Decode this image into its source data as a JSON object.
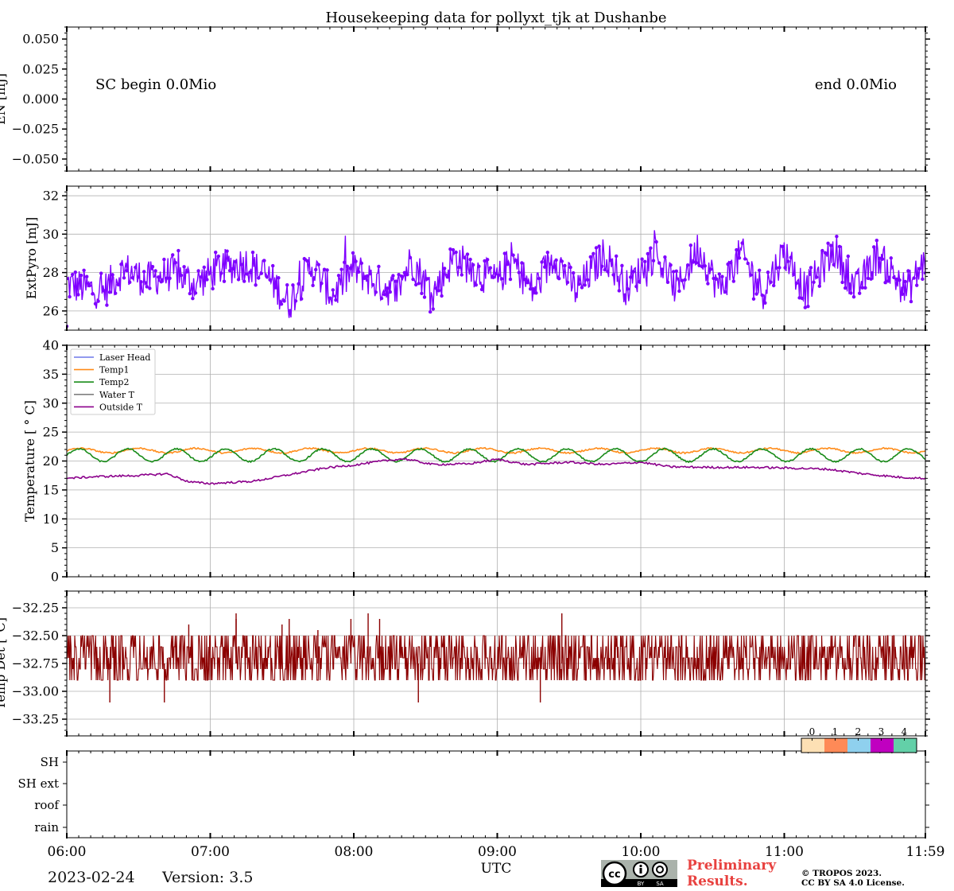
{
  "chart_data": {
    "type": "line",
    "title": "Housekeeping data for pollyxt_tjk at Dushanbe",
    "xlabel": "UTC",
    "x_ticks": [
      "06:00",
      "07:00",
      "08:00",
      "09:00",
      "10:00",
      "11:00",
      "11:59"
    ],
    "x_range_hours": [
      6.0,
      11.9833
    ],
    "panels": [
      {
        "id": "energy",
        "ylabel": "EN [mJ]",
        "ylim": [
          -0.06,
          0.06
        ],
        "yticks": [
          "0.050",
          "0.025",
          "0.000",
          "−0.025",
          "−0.050"
        ],
        "ytick_values": [
          0.05,
          0.025,
          0.0,
          -0.025,
          -0.05
        ],
        "annotations": [
          "SC begin 0.0Mio",
          "end 0.0Mio"
        ],
        "grid": false
      },
      {
        "id": "extpyro",
        "ylabel": "ExtPyro [mJ]",
        "ylim": [
          25.0,
          32.5
        ],
        "yticks": [
          "32",
          "30",
          "28",
          "26"
        ],
        "ytick_values": [
          32,
          30,
          28,
          26
        ],
        "grid": true,
        "series": [
          {
            "color": "#7f00ff",
            "marker": "dot",
            "base_points": [
              [
                6.0,
                27.4
              ],
              [
                6.25,
                27.0
              ],
              [
                6.4,
                28.2
              ],
              [
                6.55,
                27.6
              ],
              [
                6.75,
                28.0
              ],
              [
                6.9,
                27.4
              ],
              [
                7.05,
                28.2
              ],
              [
                7.25,
                28.5
              ],
              [
                7.4,
                27.8
              ],
              [
                7.55,
                26.4
              ],
              [
                7.7,
                28.4
              ],
              [
                7.85,
                26.8
              ],
              [
                8.0,
                28.2
              ],
              [
                8.15,
                27.5
              ],
              [
                8.3,
                27.0
              ],
              [
                8.4,
                28.7
              ],
              [
                8.55,
                26.9
              ],
              [
                8.7,
                28.8
              ],
              [
                8.85,
                28.1
              ],
              [
                9.0,
                27.5
              ],
              [
                9.1,
                28.7
              ],
              [
                9.25,
                27.0
              ],
              [
                9.4,
                28.9
              ],
              [
                9.55,
                27.0
              ],
              [
                9.75,
                29.0
              ],
              [
                9.9,
                27.2
              ],
              [
                10.1,
                29.0
              ],
              [
                10.25,
                27.1
              ],
              [
                10.4,
                29.3
              ],
              [
                10.55,
                27.1
              ],
              [
                10.7,
                29.0
              ],
              [
                10.85,
                27.0
              ],
              [
                11.0,
                29.1
              ],
              [
                11.15,
                27.0
              ],
              [
                11.35,
                29.2
              ],
              [
                11.5,
                27.1
              ],
              [
                11.65,
                28.9
              ],
              [
                11.85,
                27.0
              ],
              [
                11.98,
                28.6
              ]
            ],
            "amplitude": 1.2
          }
        ]
      },
      {
        "id": "temperature",
        "ylabel": "Temperature [$^\\circ$C]",
        "ylim": [
          0,
          40
        ],
        "yticks": [
          "40",
          "35",
          "30",
          "25",
          "20",
          "15",
          "10",
          "5",
          "0"
        ],
        "ytick_values": [
          40,
          35,
          30,
          25,
          20,
          15,
          10,
          5,
          0
        ],
        "grid": true,
        "legend": "top-left",
        "series": [
          {
            "name": "Laser Head",
            "color": "#6f79e8",
            "points": []
          },
          {
            "name": "Temp1",
            "color": "#ff8c1a",
            "base": 21.8,
            "wave_amplitude": 0.4,
            "wave_period_hours": 0.4
          },
          {
            "name": "Temp2",
            "color": "#1a8c1a",
            "base": 21.0,
            "wave_amplitude": 1.1,
            "wave_period_hours": 0.34
          },
          {
            "name": "Water T",
            "color": "#808080",
            "points": []
          },
          {
            "name": "Outside T",
            "color": "#8b008b",
            "points": [
              [
                6.0,
                17.0
              ],
              [
                6.2,
                17.3
              ],
              [
                6.5,
                17.5
              ],
              [
                6.7,
                17.8
              ],
              [
                6.85,
                16.4
              ],
              [
                7.0,
                16.1
              ],
              [
                7.3,
                16.5
              ],
              [
                7.5,
                17.4
              ],
              [
                7.8,
                18.8
              ],
              [
                8.0,
                19.3
              ],
              [
                8.2,
                20.0
              ],
              [
                8.35,
                20.4
              ],
              [
                8.55,
                19.4
              ],
              [
                8.8,
                19.5
              ],
              [
                9.0,
                20.3
              ],
              [
                9.2,
                19.4
              ],
              [
                9.5,
                19.8
              ],
              [
                9.75,
                19.4
              ],
              [
                10.0,
                19.8
              ],
              [
                10.2,
                19.0
              ],
              [
                10.5,
                18.9
              ],
              [
                10.8,
                18.9
              ],
              [
                11.0,
                18.8
              ],
              [
                11.3,
                18.6
              ],
              [
                11.55,
                17.8
              ],
              [
                11.8,
                17.2
              ],
              [
                11.98,
                17.0
              ]
            ]
          }
        ]
      },
      {
        "id": "detector",
        "ylabel": "Temp Det [°C]",
        "ylim": [
          -33.4,
          -32.1
        ],
        "yticks": [
          "−32.25",
          "−32.50",
          "−32.75",
          "−33.00",
          "−33.25"
        ],
        "ytick_values": [
          -32.25,
          -32.5,
          -32.75,
          -33.0,
          -33.25
        ],
        "grid": true,
        "series": [
          {
            "color": "#8b0000",
            "levels": [
              -32.5,
              -32.6,
              -32.7,
              -32.8,
              -32.9
            ],
            "spikes": [
              [
                6.3,
                -33.1
              ],
              [
                6.68,
                -33.1
              ],
              [
                6.85,
                -32.4
              ],
              [
                7.18,
                -32.35
              ],
              [
                7.18,
                -32.3
              ],
              [
                7.5,
                -32.4
              ],
              [
                7.55,
                -32.35
              ],
              [
                7.75,
                -32.45
              ],
              [
                7.98,
                -32.35
              ],
              [
                8.1,
                -32.3
              ],
              [
                8.18,
                -32.35
              ],
              [
                8.45,
                -33.1
              ],
              [
                9.3,
                -33.1
              ],
              [
                9.45,
                -32.3
              ]
            ]
          }
        ]
      },
      {
        "id": "status",
        "ylabel": "",
        "yticks": [
          "SH",
          "SH ext",
          "roof",
          "rain"
        ],
        "colorbar": {
          "labels": [
            "0",
            "1",
            "2",
            "3",
            "4"
          ],
          "colors": [
            "#fde0b4",
            "#fe8a57",
            "#8fd0ee",
            "#c000c0",
            "#63d0a8"
          ]
        }
      }
    ]
  },
  "footer": {
    "date": "2023-02-24",
    "version": "Version: 3.5",
    "preliminary_line1": "Preliminary",
    "preliminary_line2": "Results.",
    "copyright_line1": "© TROPOS 2023.",
    "copyright_line2": "CC BY SA 4.0 License.",
    "license_badge": {
      "icon": "cc-by-sa-icon",
      "text_by": "BY",
      "text_sa": "SA"
    }
  }
}
